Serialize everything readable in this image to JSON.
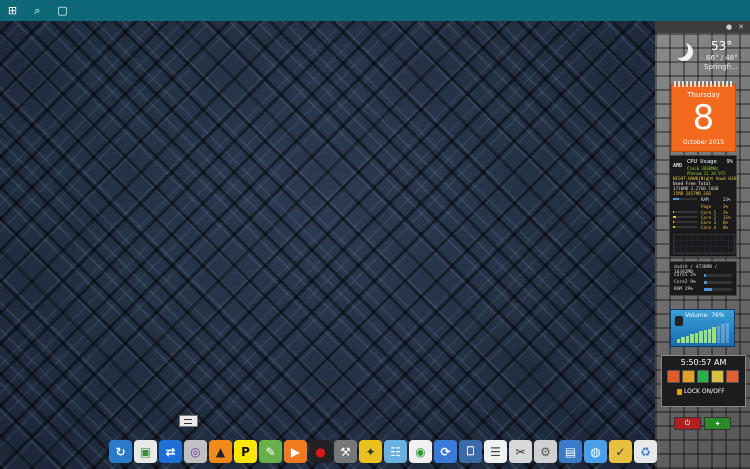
{
  "taskbar": {
    "icons": [
      "windows-icon",
      "search-icon",
      "task-view-icon"
    ],
    "glyphs": [
      "⊞",
      "⌕",
      "▢"
    ]
  },
  "sidebar": {
    "topbar_glyphs": [
      "●",
      "✕"
    ]
  },
  "weather": {
    "temp": "53°",
    "range": "66° / 48°",
    "city": "Springfi..."
  },
  "calendar": {
    "weekday": "Thursday",
    "date": "8",
    "month_year": "October 2015"
  },
  "cpu_meter": {
    "title": "CPU Usage",
    "percent": "9%",
    "clock": "Clock 3660MHz",
    "model": "Phenom II X4 975",
    "host": "NIGHT-HAWK(Night Hawk W10)",
    "mem_headers": "Used  Free  Total",
    "mem_rows": [
      "3730MB 3.27GB 16GB",
      "15MB  2417MB 2GB"
    ],
    "ram_label": "RAM",
    "ram_pct": "23%",
    "page_label": "Page",
    "page_pct": "3%",
    "cores": [
      {
        "label": "Core 1",
        "pct": "2%",
        "fill": 0.02
      },
      {
        "label": "Core 2",
        "pct": "11%",
        "fill": 0.11
      },
      {
        "label": "Core 3",
        "pct": "6%",
        "fill": 0.06
      },
      {
        "label": "Core 4",
        "pct": "8%",
        "fill": 0.08
      }
    ]
  },
  "mem_meter": {
    "title": "dxdiA / 4736MB / 16382MB",
    "rows": [
      {
        "label": "Core1",
        "pct": "2%",
        "fill": 0.02
      },
      {
        "label": "Core2",
        "pct": "9%",
        "fill": 0.09
      },
      {
        "label": "RAM",
        "pct": "29%",
        "fill": 0.29
      }
    ]
  },
  "volume": {
    "label": "Volume: 76%",
    "level": 0.76
  },
  "clock": {
    "time": "5:50:57 AM",
    "lock_label": "LOCK ON/OFF",
    "icon_colors": [
      "#e05a2a",
      "#e0a02a",
      "#2ab04a",
      "#d8c040",
      "#e06030"
    ]
  },
  "power": {
    "buttons": [
      {
        "name": "shutdown-button",
        "glyph": "⏻",
        "color": "#b02020"
      },
      {
        "name": "restart-button",
        "glyph": "✦",
        "color": "#2a8a2a"
      }
    ]
  },
  "dock": {
    "icons": [
      {
        "name": "refresh-icon",
        "glyph": "↻",
        "color": "#2a7ac8",
        "fg": "#fff"
      },
      {
        "name": "photo-viewer-icon",
        "glyph": "▣",
        "color": "#e8e8e8",
        "fg": "#3a8a3a"
      },
      {
        "name": "teamviewer-icon",
        "glyph": "⇄",
        "color": "#1d6fd6",
        "fg": "#fff"
      },
      {
        "name": "dvd-icon",
        "glyph": "◎",
        "color": "#c0c0c0",
        "fg": "#6a3aa0"
      },
      {
        "name": "vlc-icon",
        "glyph": "▲",
        "color": "#f08a1a",
        "fg": "#222"
      },
      {
        "name": "parking-p-icon",
        "glyph": "P",
        "color": "#ffe600",
        "fg": "#111"
      },
      {
        "name": "paint-tools-icon",
        "glyph": "✎",
        "color": "#6ab04a",
        "fg": "#fff"
      },
      {
        "name": "media-play-icon",
        "glyph": "▶",
        "color": "#f07a20",
        "fg": "#fff"
      },
      {
        "name": "record-icon",
        "glyph": "●",
        "color": "#222",
        "fg": "#e01818"
      },
      {
        "name": "tools-icon",
        "glyph": "⚒",
        "color": "#777",
        "fg": "#fff"
      },
      {
        "name": "puzzle-icon",
        "glyph": "✦",
        "color": "#e8c020",
        "fg": "#333"
      },
      {
        "name": "notes-icon",
        "glyph": "☷",
        "color": "#6ab0e0",
        "fg": "#fff"
      },
      {
        "name": "chrome-icon",
        "glyph": "◉",
        "color": "#f0f0f0",
        "fg": "#2a9a3a"
      },
      {
        "name": "sync-icon",
        "glyph": "⟳",
        "color": "#3a7ad8",
        "fg": "#fff"
      },
      {
        "name": "computer-icon",
        "glyph": "⎕",
        "color": "#3a6aa8",
        "fg": "#fff"
      },
      {
        "name": "document-icon",
        "glyph": "☰",
        "color": "#f0f0f0",
        "fg": "#444"
      },
      {
        "name": "scissors-icon",
        "glyph": "✂",
        "color": "#d8d8d8",
        "fg": "#333"
      },
      {
        "name": "settings-tools-icon",
        "glyph": "⚙",
        "color": "#d0d0d0",
        "fg": "#555"
      },
      {
        "name": "folder-icon",
        "glyph": "▤",
        "color": "#3a7ac8",
        "fg": "#fff"
      },
      {
        "name": "network-icon",
        "glyph": "◍",
        "color": "#4aa0e8",
        "fg": "#fff"
      },
      {
        "name": "clipboard-icon",
        "glyph": "✓",
        "color": "#e8c040",
        "fg": "#333"
      },
      {
        "name": "recycle-bin-icon",
        "glyph": "♻",
        "color": "#e8e8e8",
        "fg": "#3a7ac8"
      }
    ]
  }
}
